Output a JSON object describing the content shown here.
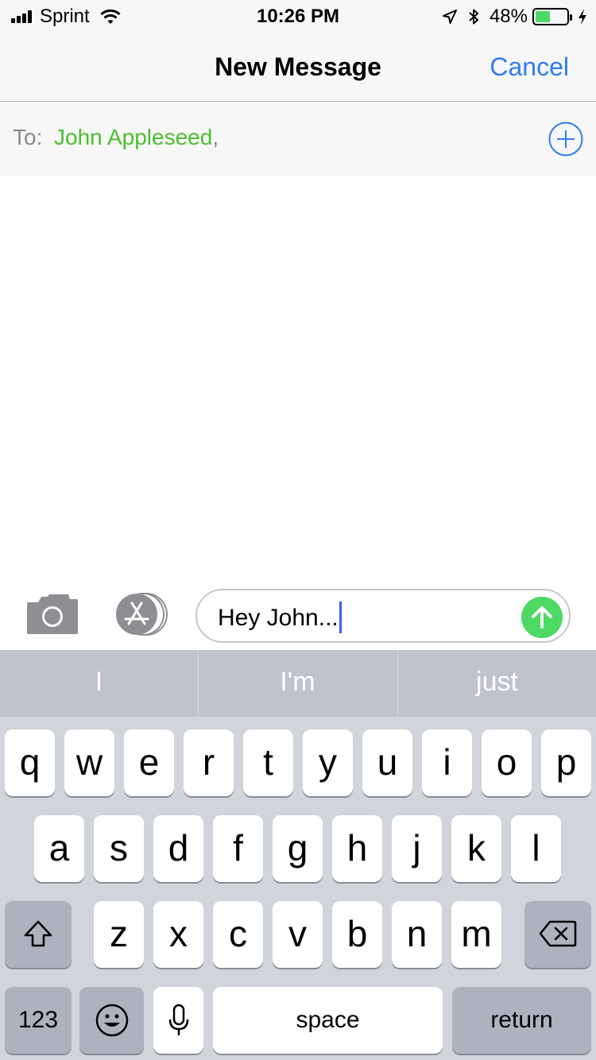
{
  "status_bar": {
    "carrier": "Sprint",
    "time": "10:26 PM",
    "battery_percent": "48%",
    "battery_level": 0.48,
    "battery_color": "#4cd964",
    "icons": [
      "signal-icon",
      "wifi-icon",
      "location-icon",
      "bluetooth-icon",
      "battery-icon",
      "charging-icon"
    ]
  },
  "nav": {
    "title": "New Message",
    "cancel_label": "Cancel",
    "accent_color": "#2f7cf6"
  },
  "to_field": {
    "label": "To:",
    "recipient": "John Appleseed",
    "separator": ",",
    "recipient_color": "#4cbf2f",
    "add_icon": "plus-circle-icon"
  },
  "compose": {
    "text": "Hey John...",
    "camera_icon": "camera-icon",
    "apps_icon": "app-store-icon",
    "send_icon": "arrow-up-icon",
    "send_color": "#4cd964"
  },
  "keyboard": {
    "suggestions": [
      "I",
      "I'm",
      "just"
    ],
    "rows": [
      [
        "q",
        "w",
        "e",
        "r",
        "t",
        "y",
        "u",
        "i",
        "o",
        "p"
      ],
      [
        "a",
        "s",
        "d",
        "f",
        "g",
        "h",
        "j",
        "k",
        "l"
      ],
      [
        "z",
        "x",
        "c",
        "v",
        "b",
        "n",
        "m"
      ]
    ],
    "numbers_label": "123",
    "space_label": "space",
    "return_label": "return",
    "shift_icon": "shift-icon",
    "delete_icon": "delete-icon",
    "emoji_icon": "emoji-icon",
    "dictation_icon": "microphone-icon"
  }
}
